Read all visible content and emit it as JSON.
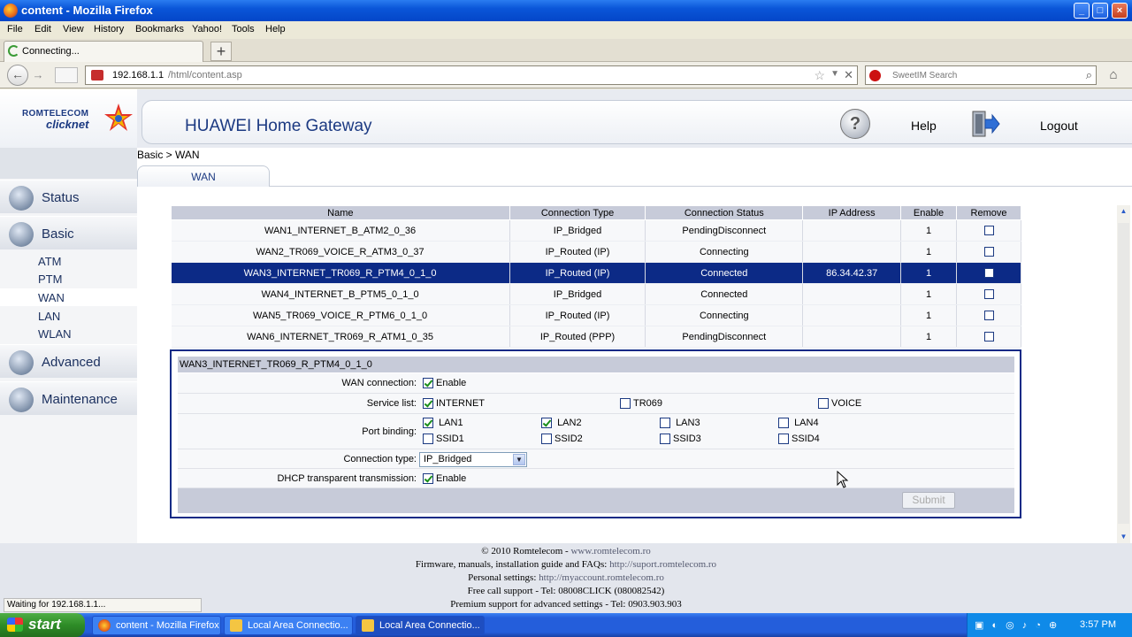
{
  "window": {
    "title": "content - Mozilla Firefox"
  },
  "menu": [
    "File",
    "Edit",
    "View",
    "History",
    "Bookmarks",
    "Yahoo!",
    "Tools",
    "Help"
  ],
  "tab": {
    "label": "Connecting..."
  },
  "url": {
    "host": "192.168.1.1",
    "path": "/html/content.asp"
  },
  "search": {
    "placeholder": "SweetIM Search"
  },
  "logo": {
    "line1": "ROMTELECOM",
    "line2": "clicknet"
  },
  "header": {
    "title": "HUAWEI Home Gateway",
    "help": "Help",
    "logout": "Logout"
  },
  "breadcrumb": "Basic > WAN",
  "page_tab": "WAN",
  "nav": {
    "status": "Status",
    "basic": "Basic",
    "sub": [
      "ATM",
      "PTM",
      "WAN",
      "LAN",
      "WLAN"
    ],
    "advanced": "Advanced",
    "maintenance": "Maintenance"
  },
  "table": {
    "headers": [
      "Name",
      "Connection Type",
      "Connection Status",
      "IP Address",
      "Enable",
      "Remove"
    ],
    "rows": [
      {
        "name": "WAN1_INTERNET_B_ATM2_0_36",
        "type": "IP_Bridged",
        "status": "PendingDisconnect",
        "ip": "",
        "enable": "1"
      },
      {
        "name": "WAN2_TR069_VOICE_R_ATM3_0_37",
        "type": "IP_Routed (IP)",
        "status": "Connecting",
        "ip": "",
        "enable": "1"
      },
      {
        "name": "WAN3_INTERNET_TR069_R_PTM4_0_1_0",
        "type": "IP_Routed (IP)",
        "status": "Connected",
        "ip": "86.34.42.37",
        "enable": "1"
      },
      {
        "name": "WAN4_INTERNET_B_PTM5_0_1_0",
        "type": "IP_Bridged",
        "status": "Connected",
        "ip": "",
        "enable": "1"
      },
      {
        "name": "WAN5_TR069_VOICE_R_PTM6_0_1_0",
        "type": "IP_Routed (IP)",
        "status": "Connecting",
        "ip": "",
        "enable": "1"
      },
      {
        "name": "WAN6_INTERNET_TR069_R_ATM1_0_35",
        "type": "IP_Routed (PPP)",
        "status": "PendingDisconnect",
        "ip": "",
        "enable": "1"
      }
    ]
  },
  "detail": {
    "title": "WAN3_INTERNET_TR069_R_PTM4_0_1_0",
    "wan_connection_label": "WAN connection:",
    "enable": "Enable",
    "service_list_label": "Service list:",
    "services": [
      "INTERNET",
      "TR069",
      "VOICE"
    ],
    "port_binding_label": "Port binding:",
    "ports": [
      "LAN1",
      "LAN2",
      "LAN3",
      "LAN4",
      "SSID1",
      "SSID2",
      "SSID3",
      "SSID4"
    ],
    "connection_type_label": "Connection type:",
    "connection_type_value": "IP_Bridged",
    "dhcp_label": "DHCP transparent transmission:",
    "submit": "Submit"
  },
  "footer": {
    "copyright": "© 2010 Romtelecom -",
    "copyright_link": "www.romtelecom.ro",
    "firmware": "Firmware, manuals, installation guide and FAQs:",
    "firmware_link": "http://suport.romtelecom.ro",
    "personal": "Personal settings:",
    "personal_link": "http://myaccount.romtelecom.ro",
    "free_call": "Free call support - Tel: 08008CLICK (080082542)",
    "premium": "Premium support for advanced settings -  Tel: 0903.903.903"
  },
  "status_text": "Waiting for 192.168.1.1...",
  "taskbar": {
    "start": "start",
    "items": [
      "content - Mozilla Firefox",
      "Local Area Connectio...",
      "Local Area Connectio..."
    ],
    "clock": "3:57 PM"
  },
  "colors": {
    "selected_row": "#0c2a86",
    "header_bg": "#c7cbd9",
    "brand": "#1c3a82"
  }
}
